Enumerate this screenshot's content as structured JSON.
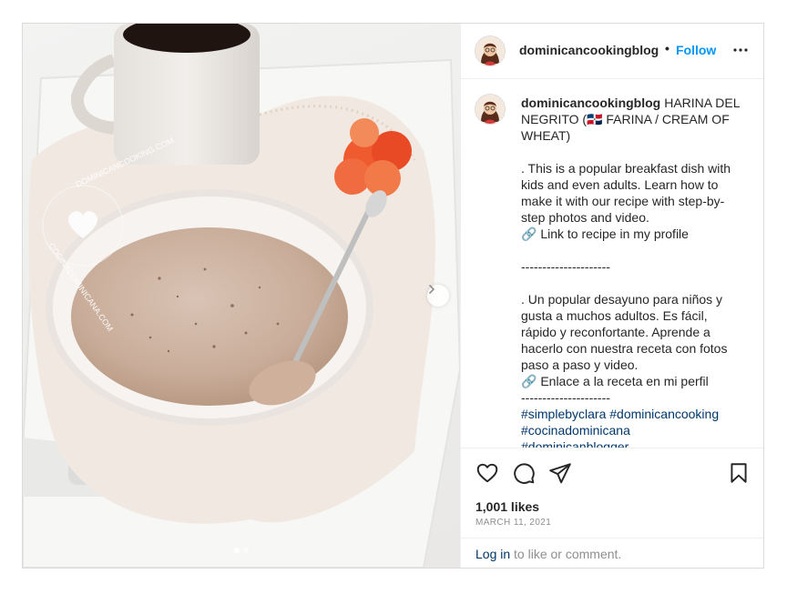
{
  "post": {
    "username": "dominicancookingblog",
    "bullet": "•",
    "follow_label": "Follow",
    "more_icon": "more-options-icon",
    "watermark_top": "dominicancooking.com",
    "watermark_bottom": "cocinadominicana.com",
    "caption": {
      "username": "dominicancookingblog",
      "text": "HARINA DEL NEGRITO (🇩🇴 FARINA / CREAM OF WHEAT)\n\n. This is a popular breakfast dish with kids and even adults. Learn how to make it with our recipe with step-by-step photos and video.\n🔗 Link to recipe in my profile\n\n---------------------\n\n. Un popular desayuno para niños y gusta a muchos adultos. Es fácil, rápido y reconfortante. Aprende a hacerlo con nuestra receta con fotos paso a paso y video.\n🔗 Enlace a la receta en mi perfil\n---------------------",
      "hashtags": [
        "#simplebyclara #dominicancooking",
        "#cocinadominicana",
        "#dominicanblogger"
      ]
    },
    "likes": "1,001 likes",
    "date": "MARCH 11, 2021",
    "login_link": "Log in",
    "login_suffix": " to like or comment.",
    "colors": {
      "accent": "#0095f6",
      "link": "#00376b",
      "muted": "#8e8e8e"
    }
  }
}
